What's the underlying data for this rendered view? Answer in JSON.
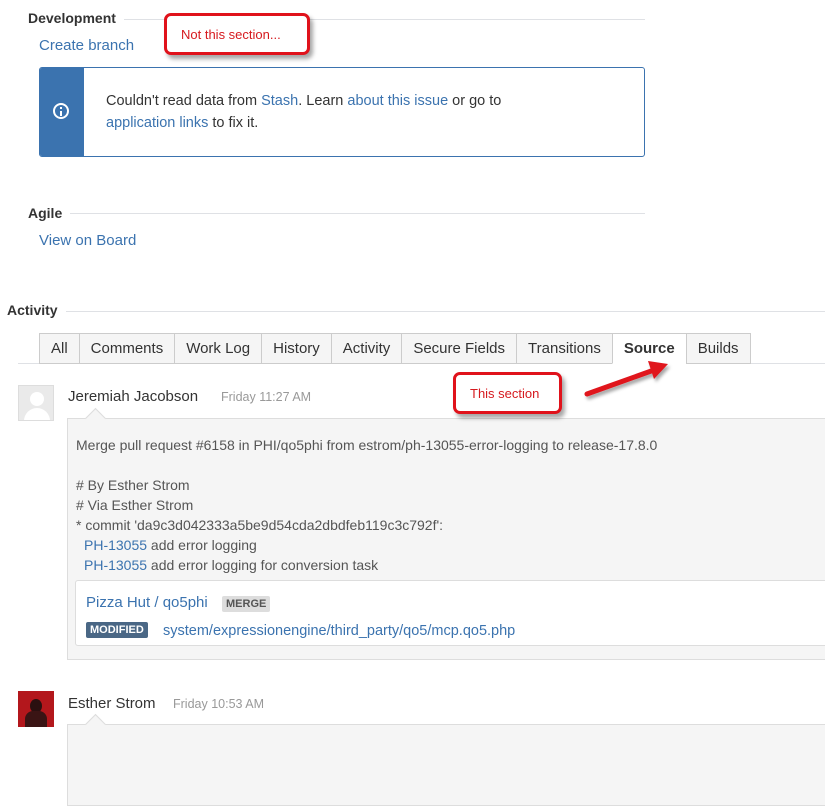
{
  "development": {
    "heading": "Development",
    "create_branch": "Create branch",
    "info": {
      "t1": "Couldn't read data from ",
      "stash_link": "Stash",
      "t2": ". Learn ",
      "about_link": "about this issue",
      "t3": " or go to",
      "app_links": "application links",
      "t4": " to fix it."
    }
  },
  "agile": {
    "heading": "Agile",
    "view_on_board": "View on Board"
  },
  "activity": {
    "heading": "Activity",
    "tabs": [
      "All",
      "Comments",
      "Work Log",
      "History",
      "Activity",
      "Secure Fields",
      "Transitions",
      "Source",
      "Builds"
    ],
    "active_tab": "Source"
  },
  "entries": [
    {
      "author": "Jeremiah Jacobson",
      "time": "Friday 11:27 AM",
      "message_line1": "Merge pull request #6158 in PHI/qo5phi from estrom/ph-13055-error-logging to release-17.8.0",
      "message_line2": "# By Esther Strom",
      "message_line3": "# Via Esther Strom",
      "message_line4": "* commit 'da9c3d042333a5be9d54cda2dbdfeb119c3c792f':",
      "issue1_key": "PH-13055",
      "issue1_text": " add error logging",
      "issue2_key": "PH-13055",
      "issue2_text": " add error logging for conversion task",
      "repo": "Pizza Hut / qo5phi",
      "merge_badge": "MERGE",
      "modified_badge": "MODIFIED",
      "file": "system/expressionengine/third_party/qo5/mcp.qo5.php"
    },
    {
      "author": "Esther Strom",
      "time": "Friday 10:53 AM"
    }
  ],
  "annotations": {
    "callout_top": "Not this section...",
    "callout_source": "This section"
  },
  "colors": {
    "link": "#3b73af",
    "annotation_red": "#e0121b",
    "info_bar": "#3b73af",
    "modified_badge": "#4a6785"
  }
}
